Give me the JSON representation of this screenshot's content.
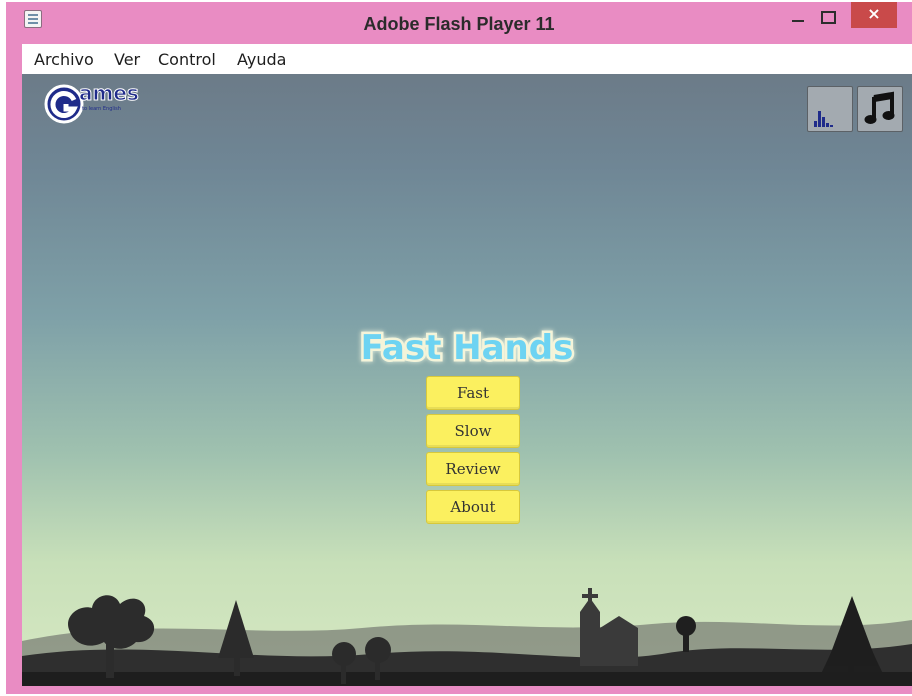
{
  "window": {
    "title": "Adobe Flash Player 11",
    "close_symbol": "×"
  },
  "menubar": {
    "items": [
      "Archivo",
      "Ver",
      "Control",
      "Ayuda"
    ]
  },
  "stage": {
    "logo": {
      "main": "Games",
      "tagline": "to learn English"
    },
    "game_title": "Fast Hands",
    "buttons": [
      "Fast",
      "Slow",
      "Review",
      "About"
    ],
    "colors": {
      "title_fill": "#6dd3f2",
      "title_outline": "#ffffff",
      "button_fill": "#fbf05f",
      "sky_top": "#6c7b88",
      "sky_bottom": "#d7e8c3",
      "silhouette": "#2f2f2f"
    }
  }
}
